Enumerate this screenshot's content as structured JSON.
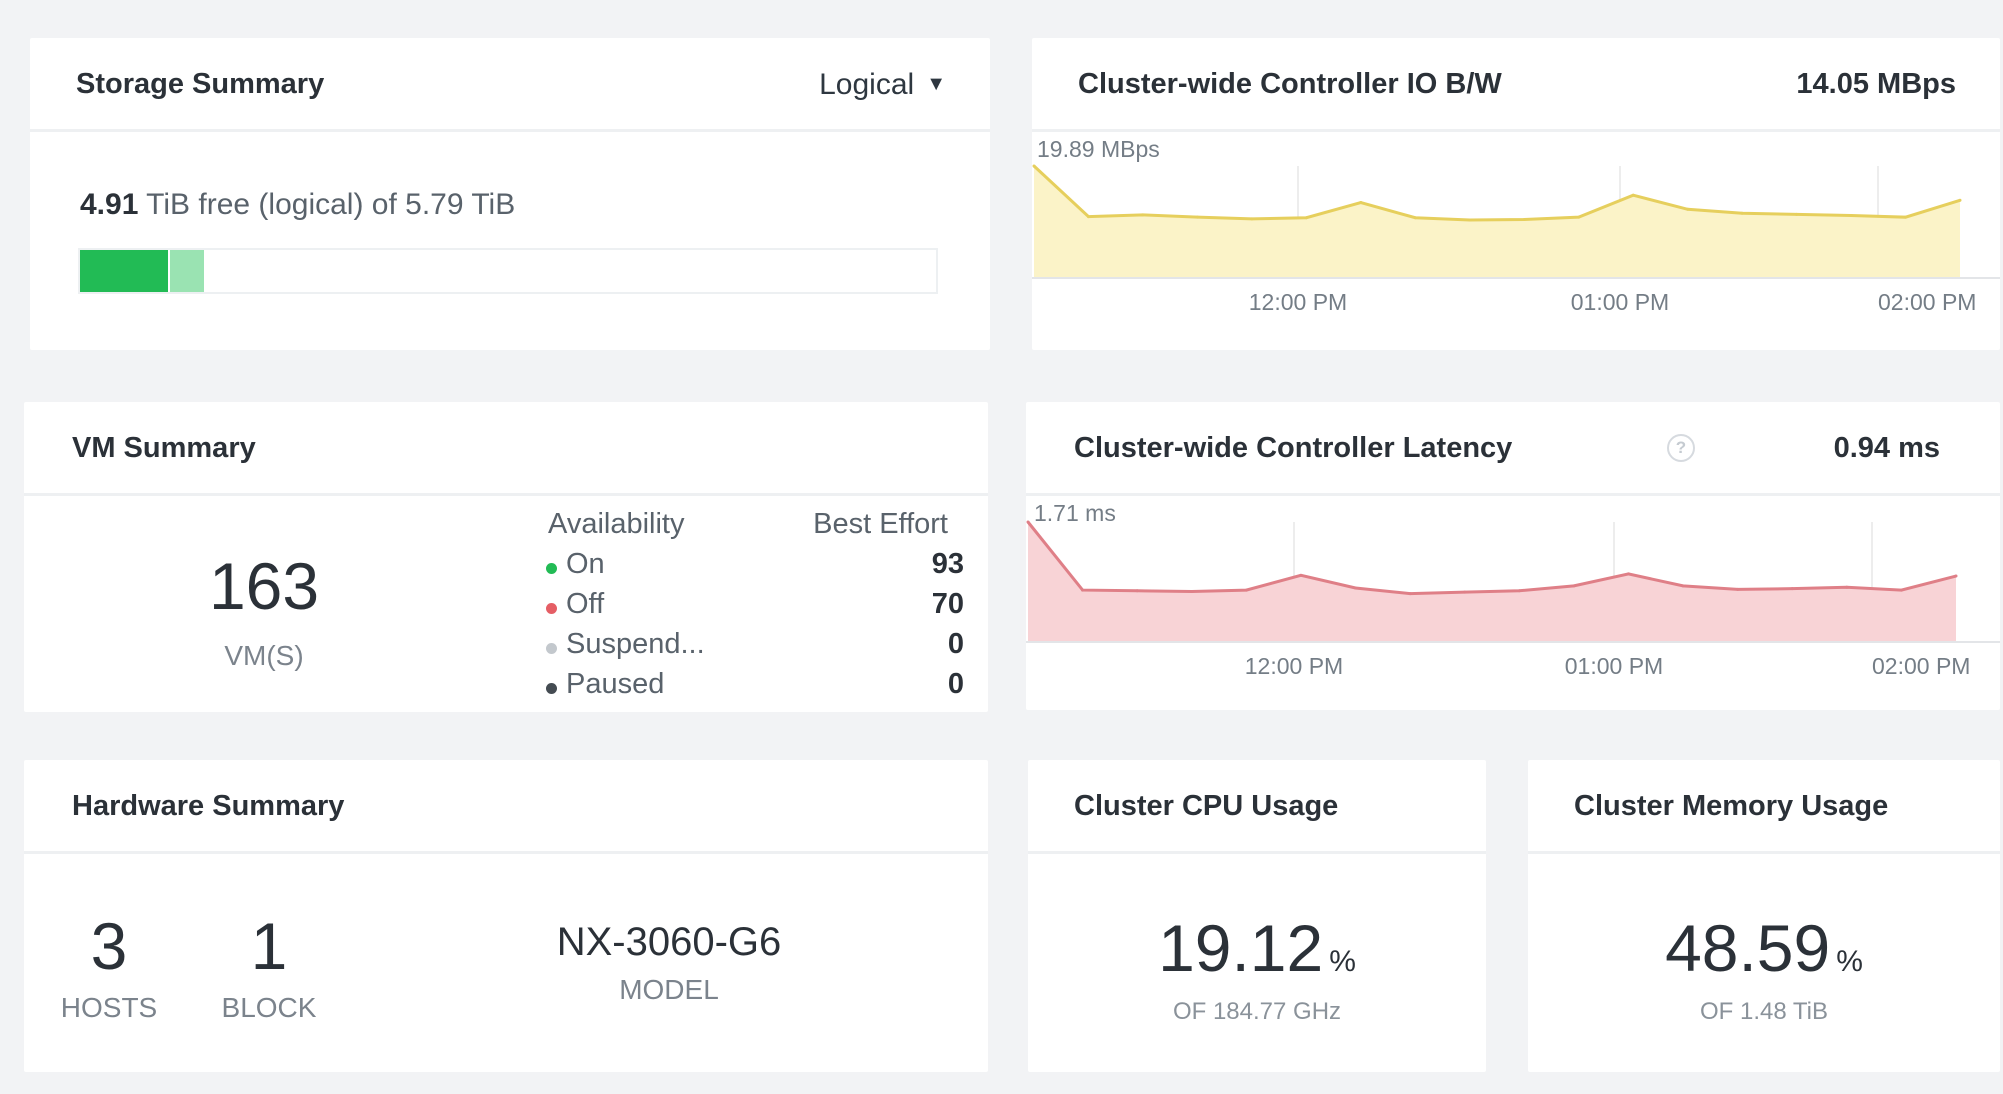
{
  "storage": {
    "title": "Storage Summary",
    "view_select": "Logical",
    "free_value": "4.91",
    "free_text": " TiB free (logical) of 5.79 TiB",
    "bar_used_fraction": 0.103,
    "bar_reserved_fraction": 0.04,
    "colors": {
      "used": "#22bb55",
      "reserved": "#9ae3b2"
    }
  },
  "io_bw": {
    "title": "Cluster-wide Controller IO B/W",
    "current": "14.05 MBps",
    "max_label": "19.89 MBps",
    "unit": "MBps",
    "colors": {
      "line": "#e6cf5d",
      "fill": "#fbf3c8"
    }
  },
  "latency": {
    "title": "Cluster-wide Controller Latency",
    "help_icon": "help-circle-icon",
    "help_glyph": "?",
    "current": "0.94 ms",
    "max_label": "1.71 ms",
    "unit": "ms",
    "colors": {
      "line": "#df7f87",
      "fill": "#f8d3d6"
    }
  },
  "vm_summary": {
    "title": "VM Summary",
    "count": "163",
    "count_label": "VM(S)",
    "col_availability": "Availability",
    "col_best_effort": "Best Effort",
    "rows": [
      {
        "label": "On",
        "value": "93",
        "color": "#22bb55"
      },
      {
        "label": "Off",
        "value": "70",
        "color": "#e55e65"
      },
      {
        "label": "Suspend...",
        "value": "0",
        "color": "#c3c8cd"
      },
      {
        "label": "Paused",
        "value": "0",
        "color": "#444b52"
      }
    ]
  },
  "hardware": {
    "title": "Hardware Summary",
    "hosts_count": "3",
    "hosts_label": "HOSTS",
    "block_count": "1",
    "block_label": "BLOCK",
    "model": "NX-3060-G6",
    "model_label": "MODEL"
  },
  "cpu": {
    "title": "Cluster CPU Usage",
    "value": "19.12",
    "unit": "%",
    "sub": "OF 184.77 GHz"
  },
  "memory": {
    "title": "Cluster Memory Usage",
    "value": "48.59",
    "unit": "%",
    "sub": "OF 1.48 TiB"
  },
  "chart_data": [
    {
      "type": "area",
      "title": "Cluster-wide Controller IO B/W",
      "ylabel": "MBps",
      "ylim": [
        0,
        19.89
      ],
      "xticks": [
        "12:00 PM",
        "01:00 PM",
        "02:00 PM"
      ],
      "x": [
        "11:15 AM",
        "11:25 AM",
        "11:35 AM",
        "11:45 AM",
        "11:55 AM",
        "12:05 PM",
        "12:15 PM",
        "12:25 PM",
        "12:35 PM",
        "12:45 PM",
        "12:55 PM",
        "01:05 PM",
        "01:15 PM",
        "01:25 PM",
        "01:35 PM",
        "01:45 PM",
        "01:55 PM",
        "02:05 PM"
      ],
      "series": [
        {
          "values": [
            19.89,
            10.9,
            11.2,
            10.8,
            10.5,
            10.7,
            13.4,
            10.7,
            10.3,
            10.4,
            10.8,
            14.7,
            12.2,
            11.5,
            11.3,
            11.1,
            10.8,
            13.8
          ]
        }
      ]
    },
    {
      "type": "area",
      "title": "Cluster-wide Controller Latency",
      "ylabel": "ms",
      "ylim": [
        0,
        1.71
      ],
      "xticks": [
        "12:00 PM",
        "01:00 PM",
        "02:00 PM"
      ],
      "x": [
        "11:15 AM",
        "11:25 AM",
        "11:35 AM",
        "11:45 AM",
        "11:55 AM",
        "12:05 PM",
        "12:15 PM",
        "12:25 PM",
        "12:35 PM",
        "12:45 PM",
        "12:55 PM",
        "01:05 PM",
        "01:15 PM",
        "01:25 PM",
        "01:35 PM",
        "01:45 PM",
        "01:55 PM",
        "02:05 PM"
      ],
      "series": [
        {
          "values": [
            1.71,
            0.74,
            0.73,
            0.72,
            0.74,
            0.95,
            0.77,
            0.69,
            0.71,
            0.73,
            0.8,
            0.97,
            0.8,
            0.75,
            0.76,
            0.78,
            0.74,
            0.94
          ]
        }
      ]
    }
  ]
}
